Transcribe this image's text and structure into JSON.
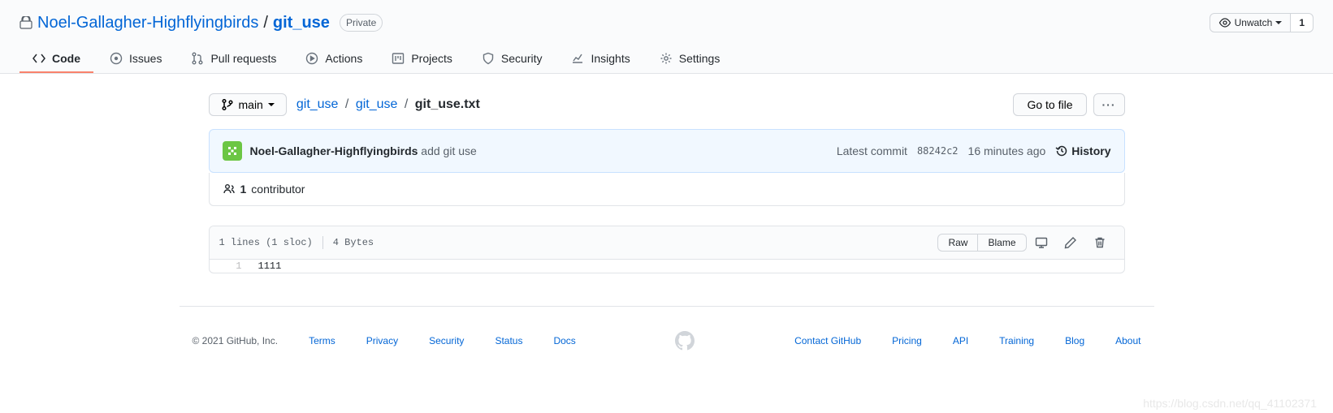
{
  "header": {
    "owner": "Noel-Gallagher-Highflyingbirds",
    "repo": "git_use",
    "visibility": "Private",
    "watch_label": "Unwatch",
    "watch_count": "1"
  },
  "tabs": [
    {
      "label": "Code"
    },
    {
      "label": "Issues"
    },
    {
      "label": "Pull requests"
    },
    {
      "label": "Actions"
    },
    {
      "label": "Projects"
    },
    {
      "label": "Security"
    },
    {
      "label": "Insights"
    },
    {
      "label": "Settings"
    }
  ],
  "branch": {
    "label": "main"
  },
  "breadcrumb": {
    "root": "git_use",
    "dir": "git_use",
    "file": "git_use.txt"
  },
  "go_to_file": "Go to file",
  "commit": {
    "author": "Noel-Gallagher-Highflyingbirds",
    "message": "add git use",
    "latest_label": "Latest commit",
    "sha": "88242c2",
    "time": "16 minutes ago",
    "history_label": "History"
  },
  "contributors": {
    "count": "1",
    "label": "contributor"
  },
  "file": {
    "info_lines": "1 lines (1 sloc)",
    "info_bytes": "4 Bytes",
    "raw": "Raw",
    "blame": "Blame",
    "lines": [
      {
        "num": "1",
        "content": "1111"
      }
    ]
  },
  "footer": {
    "copyright": "© 2021 GitHub, Inc.",
    "left": [
      "Terms",
      "Privacy",
      "Security",
      "Status",
      "Docs"
    ],
    "right": [
      "Contact GitHub",
      "Pricing",
      "API",
      "Training",
      "Blog",
      "About"
    ]
  },
  "watermark": "https://blog.csdn.net/qq_41102371"
}
